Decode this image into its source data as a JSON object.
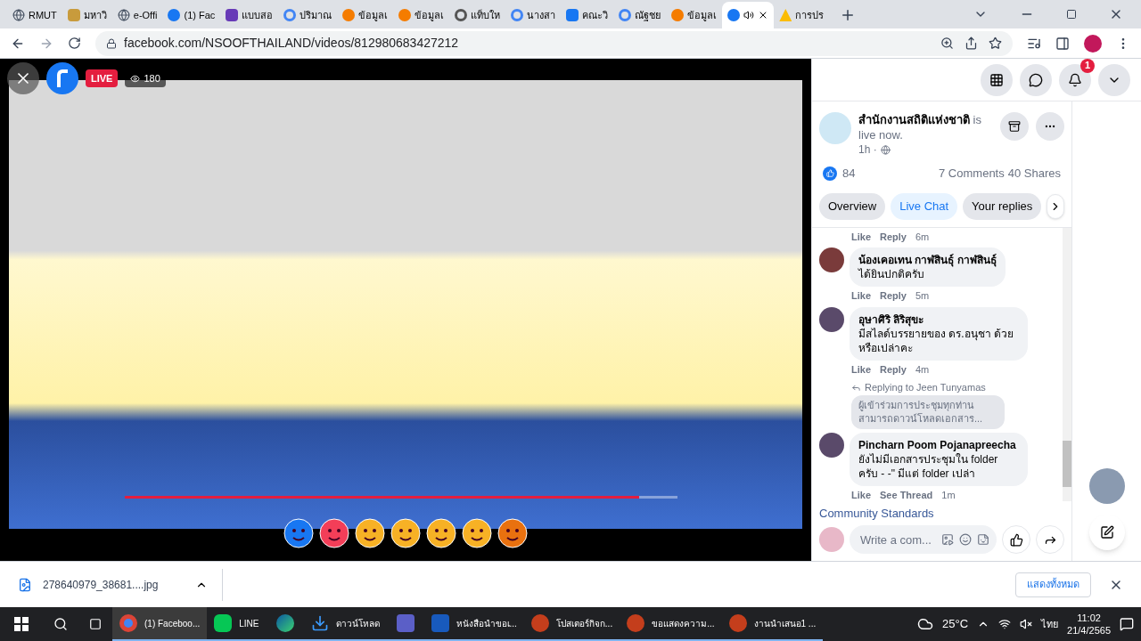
{
  "browser": {
    "tabs": [
      {
        "title": "RMUT",
        "kind": "globe",
        "selected": false
      },
      {
        "title": "มหาวิ",
        "kind": "crest",
        "selected": false
      },
      {
        "title": "e-Offi",
        "kind": "globe",
        "selected": false
      },
      {
        "title": "(1) Fac",
        "kind": "fb",
        "selected": false
      },
      {
        "title": "แบบสอ",
        "kind": "form",
        "selected": false
      },
      {
        "title": "ปริมาณ",
        "kind": "g",
        "selected": false
      },
      {
        "title": "ข้อมูลเ",
        "kind": "site",
        "selected": false
      },
      {
        "title": "ข้อมูลเ",
        "kind": "site",
        "selected": false
      },
      {
        "title": "แท็บให",
        "kind": "chrome",
        "selected": false
      },
      {
        "title": "นางสา",
        "kind": "g",
        "selected": false
      },
      {
        "title": "คณะวิ",
        "kind": "fbsq",
        "selected": false
      },
      {
        "title": "ณัฐชย",
        "kind": "g",
        "selected": false
      },
      {
        "title": "ข้อมูลเ",
        "kind": "site",
        "selected": false
      },
      {
        "kind": "fb",
        "selected": true
      },
      {
        "title": "การปร",
        "kind": "drive",
        "selected": false
      }
    ],
    "url": "facebook.com/NSOOFTHAILAND/videos/812980683427212"
  },
  "video": {
    "live_badge": "LIVE",
    "viewers": "180",
    "progress": {
      "level": 0.93
    }
  },
  "nav": {
    "notifications": "1"
  },
  "post": {
    "author": "สำนักงานสถิติแห่งชาติ",
    "status": " is live now.",
    "time": "1h ·",
    "likes": "84",
    "comments": "7 Comments",
    "shares": "40 Shares",
    "tabs": [
      {
        "label": "Overview",
        "selected": false
      },
      {
        "label": "Live Chat",
        "selected": true
      },
      {
        "label": "Your replies",
        "selected": false
      }
    ]
  },
  "comments": [
    {
      "kind": "actions",
      "actions": [
        "Like",
        "Reply"
      ],
      "time": "6m"
    },
    {
      "kind": "comment",
      "name": "น้องเคอเทน กาฬสินธุ์ กาฬสินธุ์",
      "text": "ได้ยินปกติครับ",
      "actions": [
        "Like",
        "Reply"
      ],
      "time": "5m"
    },
    {
      "kind": "comment",
      "name": "อุษาศิริ ลิริสุขะ",
      "text": "มีสไลด์บรรยายของ ดร.อนุชา ด้วย หรือเปล่าคะ",
      "actions": [
        "Like",
        "Reply"
      ],
      "time": "4m"
    },
    {
      "kind": "reply",
      "replying": "Replying to Jeen Tunyamas",
      "text": "ผู้เข้าร่วมการประชุมทุกท่าน สามารถดาวน์โหลดเอกสาร..."
    },
    {
      "kind": "comment",
      "name": "Pincharn Poom Pojanapreecha",
      "text": "ยังไม่มีเอกสารประชุมใน folder ครับ - -\" มีแต่ folder เปล่า",
      "actions": [
        "Like",
        "See Thread"
      ],
      "time": "1m"
    }
  ],
  "community_link": "Community Standards",
  "composer": {
    "placeholder": "Write a com..."
  },
  "download": {
    "file": "278640979_38681....jpg",
    "show_all": "แสดงทั้งหมด"
  },
  "taskbar": {
    "apps": [
      {
        "label": "(1) Faceboo...",
        "kind": "chrome",
        "selected": true
      },
      {
        "label": "LINE",
        "kind": "line",
        "selected": false
      },
      {
        "kind": "edge",
        "selected": false
      },
      {
        "label": "ดาวน์โหลด",
        "kind": "download",
        "selected": false
      },
      {
        "kind": "teams",
        "selected": false
      },
      {
        "label": "หนังสือนำขอเ...",
        "kind": "word",
        "selected": false
      },
      {
        "label": "โปสเตอร์กิจก...",
        "kind": "ppt",
        "selected": false
      },
      {
        "label": "ขอแสดงความ...",
        "kind": "ppt",
        "selected": false
      },
      {
        "label": "งานนำเสนอ1 ...",
        "kind": "ppt",
        "selected": false
      }
    ],
    "temperature": "25°C",
    "language": "ไทย",
    "time": "11:02",
    "date": "21/4/2565"
  }
}
